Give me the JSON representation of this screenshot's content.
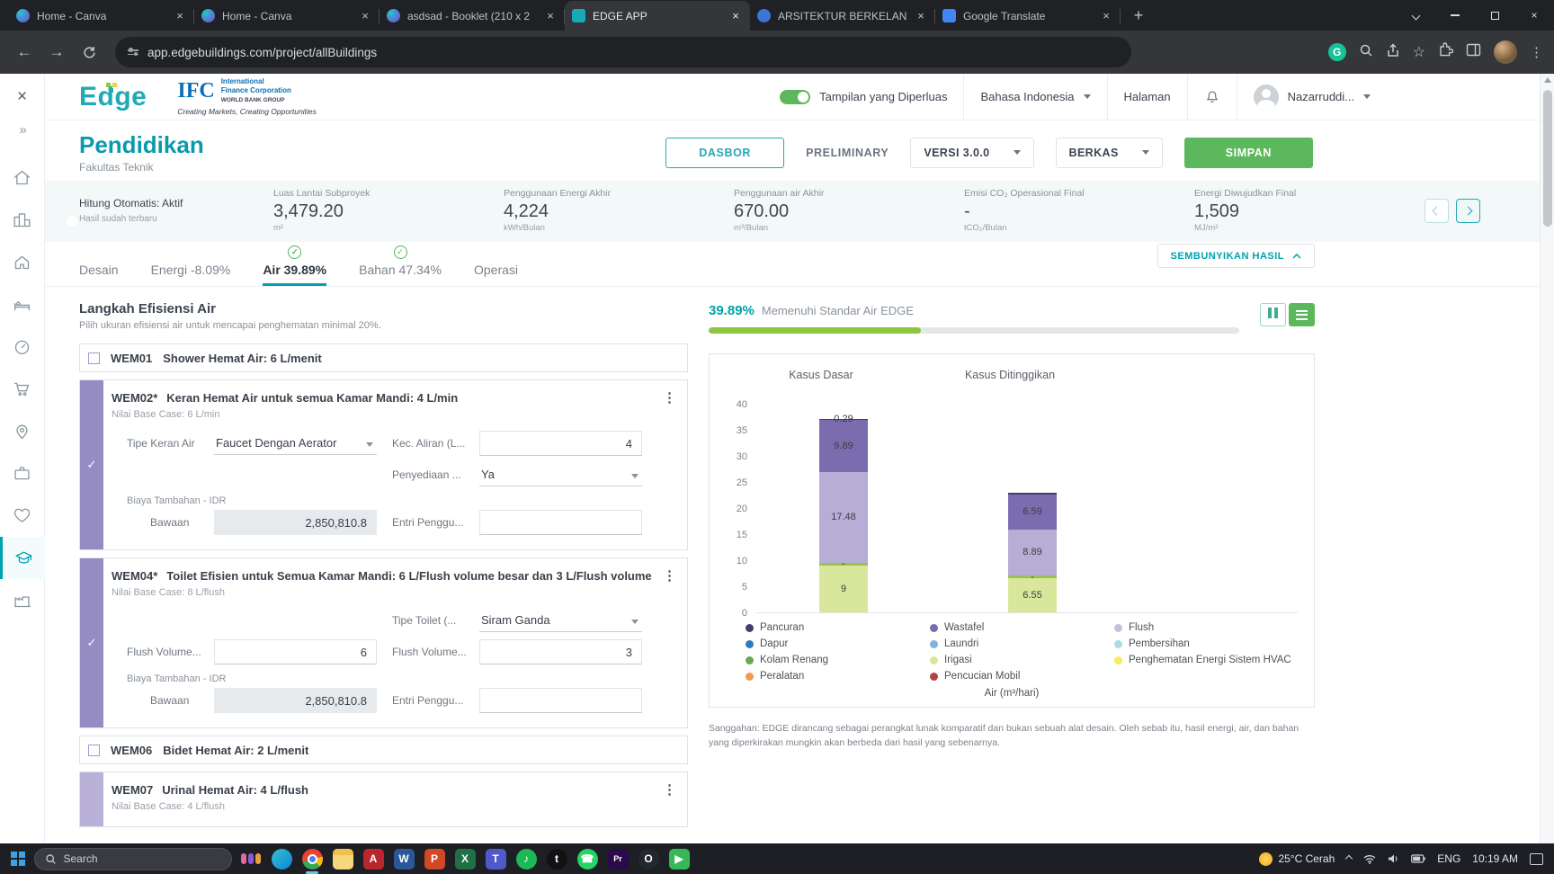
{
  "browser": {
    "tabs": [
      {
        "title": "Home - Canva",
        "favicon": "canva",
        "active": false
      },
      {
        "title": "Home - Canva",
        "favicon": "canva",
        "active": false
      },
      {
        "title": "asdsad - Booklet (210 x 2",
        "favicon": "canva",
        "active": false
      },
      {
        "title": "EDGE APP",
        "favicon": "edge-app",
        "active": true
      },
      {
        "title": "ARSITEKTUR BERKELANJU",
        "favicon": "person",
        "active": false
      },
      {
        "title": "Google Translate",
        "favicon": "translate",
        "active": false
      }
    ],
    "url": "app.edgebuildings.com/project/allBuildings"
  },
  "header": {
    "logo_text": "Edge",
    "ifc": {
      "abbr": "IFC",
      "line1": "International",
      "line2": "Finance Corporation",
      "line3": "WORLD BANK GROUP",
      "tagline": "Creating Markets, Creating Opportunities"
    },
    "expanded_label": "Tampilan yang Diperluas",
    "language": "Bahasa Indonesia",
    "page_label": "Halaman",
    "user": "Nazarruddi..."
  },
  "sidebar": {
    "icons": [
      {
        "id": "home"
      },
      {
        "id": "buildings"
      },
      {
        "id": "house"
      },
      {
        "id": "bedroom"
      },
      {
        "id": "meter"
      },
      {
        "id": "cart"
      },
      {
        "id": "map"
      },
      {
        "id": "briefcase"
      },
      {
        "id": "health"
      },
      {
        "id": "education",
        "active": true
      },
      {
        "id": "factory"
      }
    ]
  },
  "title": {
    "name": "Pendidikan",
    "subtitle": "Fakultas Teknik"
  },
  "actions": {
    "dashboard": "DASBOR",
    "status": "PRELIMINARY",
    "version": "VERSI 3.0.0",
    "files": "BERKAS",
    "save": "SIMPAN"
  },
  "stats": {
    "auto_label": "Hitung Otomatis: Aktif",
    "status_text": "Hasil sudah terbaru",
    "metrics": [
      {
        "label": "Luas Lantai Subproyek",
        "value": "3,479.20",
        "unit": "m²"
      },
      {
        "label": "Penggunaan Energi Akhir",
        "value": "4,224",
        "unit": "kWh/Bulan"
      },
      {
        "label": "Penggunaan air Akhir",
        "value": "670.00",
        "unit": "m³/Bulan"
      },
      {
        "label": "Emisi CO₂ Operasional Final",
        "value": "-",
        "unit": "tCO₂/Bulan"
      },
      {
        "label": "Energi Diwujudkan Final",
        "value": "1,509",
        "unit": "MJ/m²"
      }
    ]
  },
  "nav_tabs": [
    {
      "label": "Desain",
      "active": false,
      "check": false
    },
    {
      "label": "Energi -8.09%",
      "active": false,
      "check": false
    },
    {
      "label": "Air 39.89%",
      "active": true,
      "check": true
    },
    {
      "label": "Bahan 47.34%",
      "active": false,
      "check": true
    },
    {
      "label": "Operasi",
      "active": false,
      "check": false
    }
  ],
  "hide_results_label": "SEMBUNYIKAN HASIL",
  "measures": {
    "section_title": "Langkah Efisiensi Air",
    "section_subtitle": "Pilih ukuran efisiensi air untuk mencapai penghematan minimal 20%.",
    "wem01": {
      "code": "WEM01",
      "title": "Shower Hemat Air: 6 L/menit"
    },
    "wem02": {
      "code": "WEM02*",
      "title": "Keran Hemat Air untuk semua Kamar Mandi: 4 L/min",
      "base_case": "Nilai Base Case: 6 L/min",
      "faucet_type_label": "Tipe Keran Air",
      "faucet_type_value": "Faucet Dengan Aerator",
      "flow_rate_label": "Kec. Aliran (L...",
      "flow_rate_value": "4",
      "supply_label": "Penyediaan ...",
      "supply_value": "Ya",
      "cost_section_label": "Biaya Tambahan - IDR",
      "default_label": "Bawaan",
      "default_value": "2,850,810.8",
      "user_entry_label": "Entri Penggu..."
    },
    "wem04": {
      "code": "WEM04*",
      "title": "Toilet Efisien untuk Semua Kamar Mandi: 6 L/Flush volume besar dan 3 L/Flush volume ...",
      "base_case": "Nilai Base Case: 8 L/flush",
      "toilet_type_label": "Tipe Toilet (...",
      "toilet_type_value": "Siram Ganda",
      "flush_large_label": "Flush Volume...",
      "flush_large_value": "6",
      "flush_small_label": "Flush Volume...",
      "flush_small_value": "3",
      "cost_section_label": "Biaya Tambahan - IDR",
      "default_label": "Bawaan",
      "default_value": "2,850,810.8",
      "user_entry_label": "Entri Penggu..."
    },
    "wem06": {
      "code": "WEM06",
      "title": "Bidet Hemat Air: 2 L/menit"
    },
    "wem07": {
      "code": "WEM07",
      "title": "Urinal Hemat Air: 4 L/flush",
      "base_case": "Nilai Base Case: 4 L/flush"
    }
  },
  "results": {
    "percent": "39.89%",
    "standard_label": "Memenuhi Standar Air EDGE",
    "progress_percent": 40,
    "disclaimer": "Sanggahan: EDGE dirancang sebagai perangkat lunak komparatif dan bukan sebuah alat desain. Oleh sebab itu, hasil energi, air, dan bahan yang diperkirakan mungkin akan berbeda dari hasil yang sebenarnya."
  },
  "chart_data": {
    "type": "bar",
    "stacked": true,
    "xlabel": "Air (m³/hari)",
    "ylim": [
      0,
      40
    ],
    "yticks": [
      0,
      5,
      10,
      15,
      20,
      25,
      30,
      35,
      40
    ],
    "categories": [
      "Kasus Dasar",
      "Kasus Ditinggikan"
    ],
    "bars": [
      {
        "category": "Kasus Dasar",
        "segments_bottom_to_top": [
          {
            "label": "9",
            "value": 9,
            "color": "#d9e79c"
          },
          {
            "label": "-",
            "value": 0.5,
            "color": "#9dc053"
          },
          {
            "label": "17.48",
            "value": 17.48,
            "color": "#b7add5"
          },
          {
            "label": "9.89",
            "value": 9.89,
            "color": "#7a6cae"
          },
          {
            "label": "0.29",
            "value": 0.29,
            "color": "#453d6d"
          }
        ]
      },
      {
        "category": "Kasus Ditinggikan",
        "segments_bottom_to_top": [
          {
            "label": "6.55",
            "value": 6.55,
            "color": "#d9e79c"
          },
          {
            "label": "-",
            "value": 0.5,
            "color": "#9dc053"
          },
          {
            "label": "8.89",
            "value": 8.89,
            "color": "#b7add5"
          },
          {
            "label": "6.59",
            "value": 6.59,
            "color": "#7a6cae"
          },
          {
            "label": "-",
            "value": 0.4,
            "color": "#453d6d"
          }
        ]
      }
    ],
    "legend": [
      {
        "label": "Pancuran",
        "color": "#453d6d"
      },
      {
        "label": "Wastafel",
        "color": "#7a6cae"
      },
      {
        "label": "Flush",
        "color": "#c6bede"
      },
      {
        "label": "Dapur",
        "color": "#2e79c0"
      },
      {
        "label": "Laundri",
        "color": "#7fb2de"
      },
      {
        "label": "Pembersihan",
        "color": "#abdbe8"
      },
      {
        "label": "Kolam Renang",
        "color": "#69a94f"
      },
      {
        "label": "Irigasi",
        "color": "#d9e79c"
      },
      {
        "label": "Penghematan Energi Sistem HVAC",
        "color": "#f6ee54"
      },
      {
        "label": "Peralatan",
        "color": "#ef9a4e"
      },
      {
        "label": "Pencucian Mobil",
        "color": "#b2423e"
      }
    ]
  },
  "taskbar": {
    "search_placeholder": "Search",
    "apps": [
      "people",
      "edge",
      "chrome",
      "explorer",
      "acrobat",
      "word",
      "powerpoint",
      "excel",
      "teams",
      "spotify",
      "tiktok",
      "whatsapp",
      "premiere",
      "obs",
      "shareit"
    ],
    "weather": "25°C Cerah",
    "language": "ENG",
    "time": "10:19 AM"
  }
}
